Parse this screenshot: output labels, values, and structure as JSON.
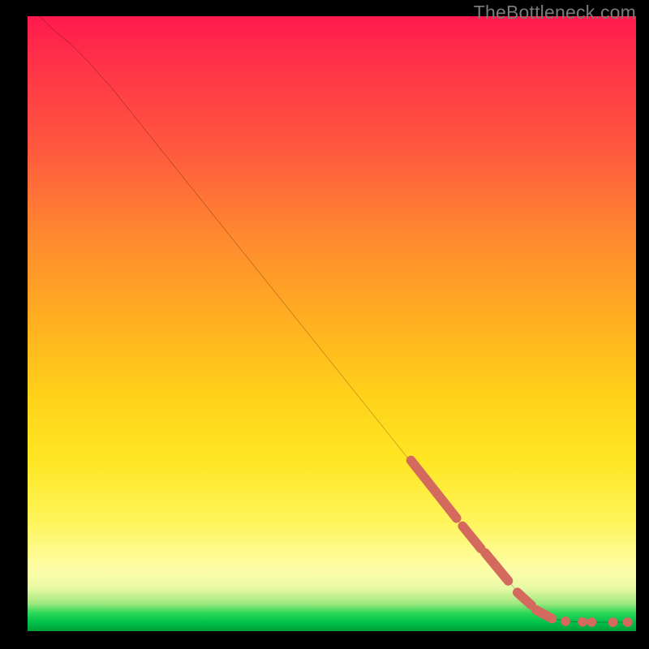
{
  "watermark": "TheBottleneck.com",
  "colors": {
    "dot": "#d46a5e",
    "line": "#000000"
  },
  "chart_data": {
    "type": "line",
    "title": "",
    "xlabel": "",
    "ylabel": "",
    "xlim": [
      0,
      100
    ],
    "ylim": [
      0,
      100
    ],
    "grid": false,
    "legend": false,
    "curve": [
      {
        "x": 2,
        "y": 100
      },
      {
        "x": 4,
        "y": 98
      },
      {
        "x": 7,
        "y": 95.5
      },
      {
        "x": 10,
        "y": 92.5
      },
      {
        "x": 14,
        "y": 88
      },
      {
        "x": 20,
        "y": 80.5
      },
      {
        "x": 30,
        "y": 68
      },
      {
        "x": 40,
        "y": 55.5
      },
      {
        "x": 50,
        "y": 43
      },
      {
        "x": 60,
        "y": 30.5
      },
      {
        "x": 70,
        "y": 18
      },
      {
        "x": 80,
        "y": 6
      },
      {
        "x": 85,
        "y": 1.5
      },
      {
        "x": 88,
        "y": 0.6
      },
      {
        "x": 92,
        "y": 0.4
      },
      {
        "x": 96,
        "y": 0.4
      },
      {
        "x": 99,
        "y": 0.4
      }
    ],
    "dot_segments": [
      {
        "from": {
          "x": 63,
          "y": 27
        },
        "to": {
          "x": 70.5,
          "y": 17.5
        }
      },
      {
        "from": {
          "x": 71.5,
          "y": 16.2
        },
        "to": {
          "x": 74.5,
          "y": 12.5
        }
      },
      {
        "from": {
          "x": 75.2,
          "y": 11.8
        },
        "to": {
          "x": 79,
          "y": 7.2
        }
      },
      {
        "from": {
          "x": 80.5,
          "y": 5.3
        },
        "to": {
          "x": 82.8,
          "y": 3.2
        }
      },
      {
        "from": {
          "x": 83.6,
          "y": 2.4
        },
        "to": {
          "x": 86.2,
          "y": 1.0
        }
      }
    ],
    "dot_points": [
      {
        "x": 88.4,
        "y": 0.55
      },
      {
        "x": 91.2,
        "y": 0.45
      },
      {
        "x": 92.7,
        "y": 0.42
      },
      {
        "x": 96.2,
        "y": 0.4
      },
      {
        "x": 98.6,
        "y": 0.4
      }
    ]
  }
}
